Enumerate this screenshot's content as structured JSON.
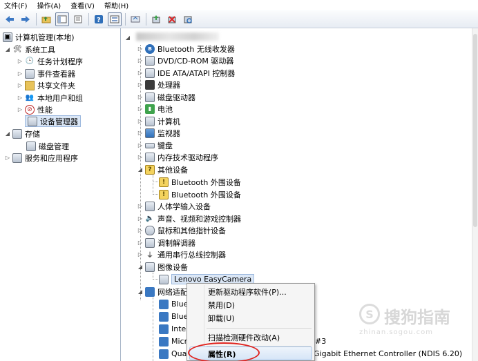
{
  "menubar": {
    "items": [
      "文件(F)",
      "操作(A)",
      "查看(V)",
      "帮助(H)"
    ]
  },
  "toolbar": {
    "icons": [
      "back-arrow-icon",
      "forward-arrow-icon",
      "up-folder-icon",
      "show-tree-icon",
      "export-list-icon",
      "help-icon",
      "properties-icon",
      "action-icon",
      "update-driver-icon",
      "uninstall-icon",
      "scan-hardware-icon"
    ]
  },
  "left_tree": {
    "root": "计算机管理(本地)",
    "system_tools": "系统工具",
    "system_children": [
      "任务计划程序",
      "事件查看器",
      "共享文件夹",
      "本地用户和组",
      "性能",
      "设备管理器"
    ],
    "storage": "存储",
    "storage_children": [
      "磁盘管理"
    ],
    "services": "服务和应用程序"
  },
  "device_tree": {
    "categories": [
      "Bluetooth 无线收发器",
      "DVD/CD-ROM 驱动器",
      "IDE ATA/ATAPI 控制器",
      "处理器",
      "磁盘驱动器",
      "电池",
      "计算机",
      "监视器",
      "键盘",
      "内存技术驱动程序",
      "其他设备"
    ],
    "other_children": [
      "Bluetooth 外围设备",
      "Bluetooth 外围设备"
    ],
    "categories2": [
      "人体学输入设备",
      "声音、视频和游戏控制器",
      "鼠标和其他指针设备",
      "调制解调器",
      "通用串行总线控制器",
      "图像设备"
    ],
    "camera": "Lenovo EasyCamera",
    "network": "网络适配",
    "network_children": [
      "Blue",
      "Blue",
      "Intel",
      "Micr",
      "Qua"
    ],
    "network_suffix_1": "#3",
    "network_suffix_2": "Gigabit Ethernet Controller (NDIS 6.20)"
  },
  "context_menu": {
    "items": [
      "更新驱动程序软件(P)...",
      "禁用(D)",
      "卸载(U)",
      "扫描检测硬件改动(A)",
      "属性(R)"
    ]
  },
  "watermark": {
    "main": "搜狗指南",
    "sub": "zhinan.sogou.com"
  },
  "colors": {
    "highlight_ellipse": "#e0241f",
    "selection": "#dbe7f6"
  }
}
